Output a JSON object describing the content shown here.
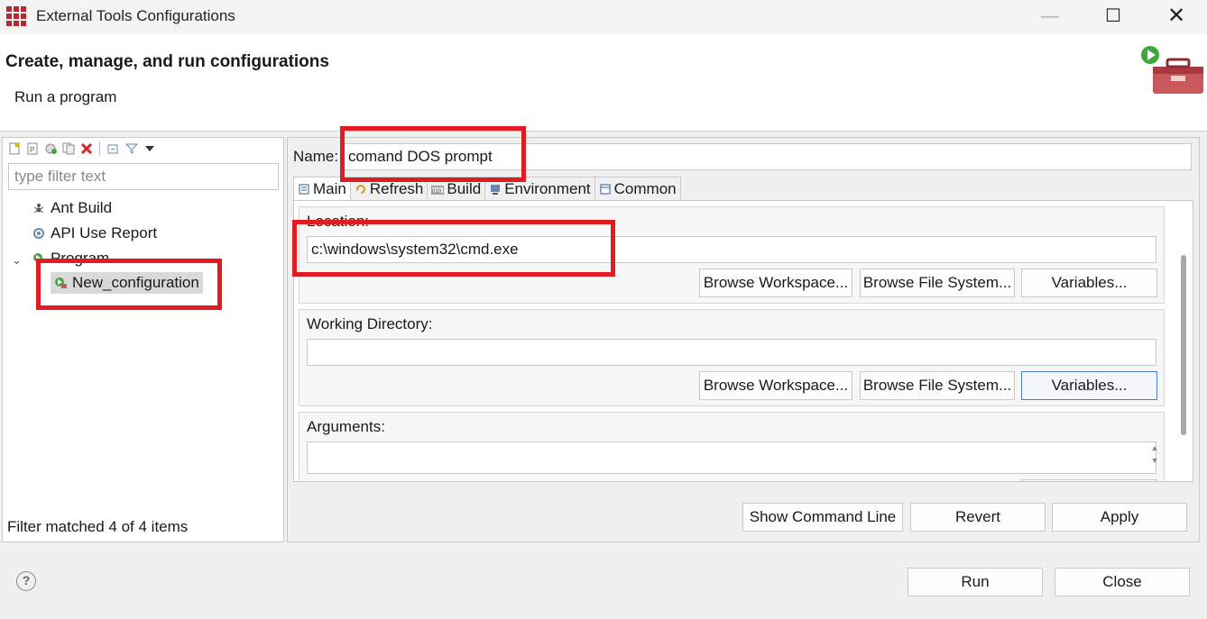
{
  "window": {
    "title": "External Tools Configurations",
    "minimize": "—",
    "maximize": "☐",
    "close": "✕"
  },
  "header": {
    "title": "Create, manage, and run configurations",
    "subtitle": "Run a program",
    "icon": "toolbox-run-icon"
  },
  "left": {
    "toolbar_icons": [
      "new-config-icon",
      "new-prototype-icon",
      "export-icon",
      "duplicate-icon",
      "delete-icon",
      "collapse-all-icon",
      "filter-icon",
      "view-menu-icon"
    ],
    "filter_placeholder": "type filter text",
    "tree": {
      "ant_build": "Ant Build",
      "api_use_report": "API Use Report",
      "program": "Program",
      "new_configuration": "New_configuration"
    },
    "status": "Filter matched 4 of 4 items"
  },
  "right": {
    "name_label": "Name:",
    "name_value": "comand DOS prompt",
    "tabs": [
      "Main",
      "Refresh",
      "Build",
      "Environment",
      "Common"
    ],
    "location": {
      "label": "Location:",
      "value": "c:\\windows\\system32\\cmd.exe",
      "browse_workspace": "Browse Workspace...",
      "browse_fs": "Browse File System...",
      "variables": "Variables..."
    },
    "working_dir": {
      "label": "Working Directory:",
      "value": "",
      "browse_workspace": "Browse Workspace...",
      "browse_fs": "Browse File System...",
      "variables": "Variables..."
    },
    "arguments": {
      "label": "Arguments:",
      "value": ""
    },
    "show_command_line": "Show Command Line",
    "revert": "Revert",
    "apply": "Apply"
  },
  "footer": {
    "help": "?",
    "run": "Run",
    "close": "Close"
  },
  "colors": {
    "annotation_red": "#e21a22",
    "app_red": "#b8272e"
  }
}
